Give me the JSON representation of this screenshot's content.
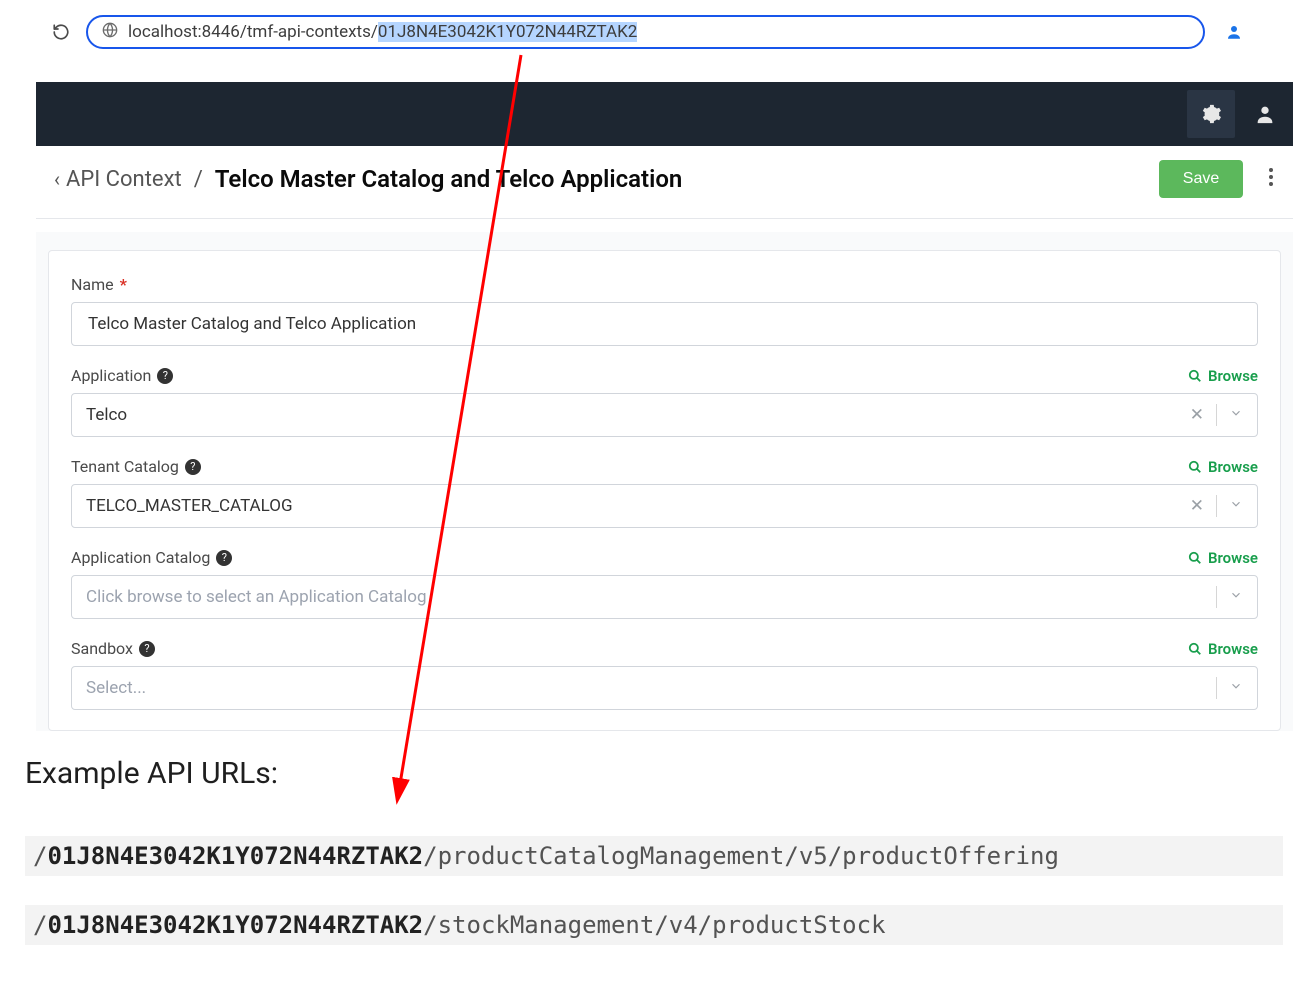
{
  "browser": {
    "url_prefix": "localhost:8446/tmf-api-contexts/",
    "url_id": "01J8N4E3042K1Y072N44RZTAK2"
  },
  "header": {
    "back_label": "API Context",
    "separator": "/",
    "title": "Telco Master Catalog and Telco Application",
    "save_label": "Save"
  },
  "form": {
    "name": {
      "label": "Name",
      "value": "Telco Master Catalog and Telco Application",
      "required": true
    },
    "application": {
      "label": "Application",
      "value": "Telco",
      "browse": "Browse"
    },
    "tenant_catalog": {
      "label": "Tenant Catalog",
      "value": "TELCO_MASTER_CATALOG",
      "browse": "Browse"
    },
    "application_catalog": {
      "label": "Application Catalog",
      "placeholder": "Click browse to select an Application Catalog",
      "browse": "Browse"
    },
    "sandbox": {
      "label": "Sandbox",
      "placeholder": "Select...",
      "browse": "Browse"
    }
  },
  "examples": {
    "heading": "Example API URLs:",
    "url1_id": "01J8N4E3042K1Y072N44RZTAK2",
    "url1_path": "/productCatalogManagement/v5/productOffering",
    "url2_id": "01J8N4E3042K1Y072N44RZTAK2",
    "url2_path": "/stockManagement/v4/productStock"
  }
}
